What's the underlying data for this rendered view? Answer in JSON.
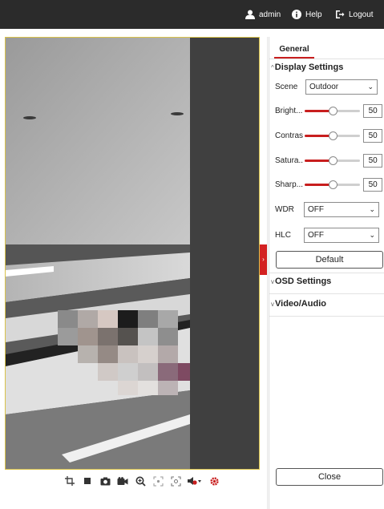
{
  "topbar": {
    "user": "admin",
    "help": "Help",
    "logout": "Logout",
    "icons": [
      "user-icon",
      "help-icon",
      "logout-icon"
    ]
  },
  "panel": {
    "tab": "General",
    "display_settings": {
      "title": "Display Settings",
      "scene_label": "Scene",
      "scene_value": "Outdoor",
      "sliders": [
        {
          "label": "Bright...",
          "value": "50"
        },
        {
          "label": "Contrast",
          "value": "50"
        },
        {
          "label": "Satura...",
          "value": "50"
        },
        {
          "label": "Sharp...",
          "value": "50"
        }
      ],
      "wdr_label": "WDR",
      "wdr_value": "OFF",
      "hlc_label": "HLC",
      "hlc_value": "OFF",
      "default_button": "Default"
    },
    "osd_settings": "OSD Settings",
    "video_audio": "Video/Audio",
    "close_button": "Close"
  },
  "video_toolbar": {
    "icons": [
      "crop-icon",
      "stop-icon",
      "snapshot-icon",
      "record-icon",
      "zoom-icon",
      "focus-icon",
      "region-icon",
      "audio-icon",
      "settings-icon"
    ]
  },
  "colors": {
    "topbar_bg": "#2b2b2b",
    "accent_red": "#c81e1e",
    "video_border": "#d9c24a"
  }
}
